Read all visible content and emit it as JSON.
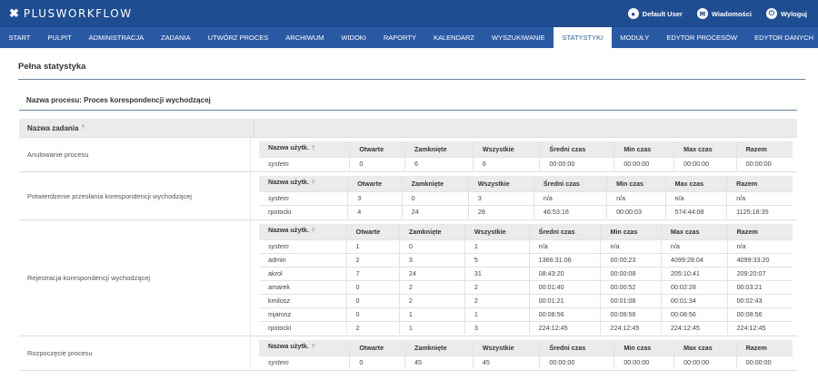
{
  "app": {
    "name": "PLUSWORKFLOW"
  },
  "user_menu": [
    {
      "label": "Default User",
      "icon": "user-icon"
    },
    {
      "label": "Wiadomości",
      "icon": "mail-icon"
    },
    {
      "label": "Wyloguj",
      "icon": "power-icon"
    }
  ],
  "nav": [
    "START",
    "PULPIT",
    "ADMINISTRACJA",
    "ZADANIA",
    "UTWÓRZ PROCES",
    "ARCHIWUM",
    "WIDOKI",
    "RAPORTY",
    "KALENDARZ",
    "WYSZUKIWANIE",
    "STATYSTYKI",
    "MODUŁY",
    "EDYTOR PROCESÓW",
    "EDYTOR DANYCH"
  ],
  "nav_active": "STATYSTYKI",
  "page_title": "Pełna statystyka",
  "process_title": "Nazwa procesu: Proces korespondencji wychodzącej",
  "outer_header": "Nazwa zadania",
  "inner_headers": [
    "Nazwa użytk.",
    "Otwarte",
    "Zamknięte",
    "Wszystkie",
    "Średni czas",
    "Min czas",
    "Max czas",
    "Razem"
  ],
  "tasks": [
    {
      "name": "Anulowanie procesu",
      "rows": [
        [
          "system",
          "0",
          "6",
          "6",
          "00:00:00",
          "00:00:00",
          "00:00:00",
          "00:00:00"
        ]
      ]
    },
    {
      "name": "Potwierdzenie przesłania korespondencji wychodzącej",
      "rows": [
        [
          "system",
          "3",
          "0",
          "3",
          "n/a",
          "n/a",
          "n/a",
          "n/a"
        ],
        [
          "rpotocki",
          "4",
          "24",
          "28",
          "46:53:16",
          "00:00:03",
          "574:44:08",
          "1125:18:35"
        ]
      ]
    },
    {
      "name": "Rejestracja korespondencji wychodzącej",
      "rows": [
        [
          "system",
          "1",
          "0",
          "1",
          "n/a",
          "n/a",
          "n/a",
          "n/a"
        ],
        [
          "admin",
          "2",
          "3",
          "5",
          "1366:31:06",
          "00:00:23",
          "4099:28:04",
          "4099:33:20"
        ],
        [
          "akrol",
          "7",
          "24",
          "31",
          "08:43:20",
          "00:00:08",
          "205:10:41",
          "209:20:07"
        ],
        [
          "amarek",
          "0",
          "2",
          "2",
          "00:01:40",
          "00:00:52",
          "00:02:28",
          "00:03:21"
        ],
        [
          "kmilosz",
          "0",
          "2",
          "2",
          "00:01:21",
          "00:01:08",
          "00:01:34",
          "00:02:43"
        ],
        [
          "mjarosz",
          "0",
          "1",
          "1",
          "00:08:56",
          "00:08:56",
          "00:08:56",
          "00:08:56"
        ],
        [
          "rpotocki",
          "2",
          "1",
          "3",
          "224:12:45",
          "224:12:45",
          "224:12:45",
          "224:12:45"
        ]
      ]
    },
    {
      "name": "Rozpoczęcie procesu",
      "rows": [
        [
          "system",
          "0",
          "45",
          "45",
          "00:00:00",
          "00:00:00",
          "00:00:00",
          "00:00:00"
        ]
      ]
    }
  ]
}
